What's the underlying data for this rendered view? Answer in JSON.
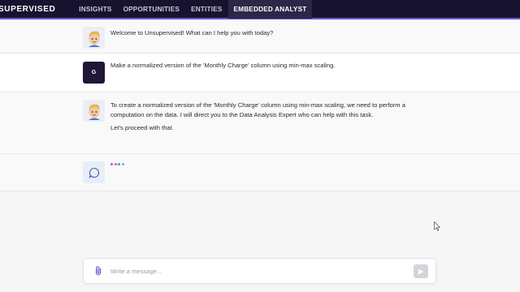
{
  "brand": "SUPERVISED",
  "nav": {
    "items": [
      {
        "label": "INSIGHTS"
      },
      {
        "label": "OPPORTUNITIES"
      },
      {
        "label": "ENTITIES"
      },
      {
        "label": "EMBEDDED ANALYST"
      }
    ],
    "active_index": 3
  },
  "conversation": {
    "messages": [
      {
        "role": "assistant",
        "avatar": "memoji-avatar",
        "paragraphs": [
          "Welcome to Unsupervised! What can I help you with today?"
        ]
      },
      {
        "role": "user",
        "avatar_initial": "G",
        "paragraphs": [
          "Make a normalized version of the 'Monthly Charge' column using min-max scaling."
        ]
      },
      {
        "role": "assistant",
        "avatar": "memoji-avatar",
        "paragraphs": [
          "To create a normalized version of the 'Monthly Charge' column using min-max scaling, we need to perform a computation on the data. I will direct you to the Data Analysis Expert who can help with this task.",
          "Let's proceed with that."
        ]
      },
      {
        "role": "assistant-typing",
        "avatar": "chat-bubble-icon"
      }
    ],
    "typing_dot_colors": [
      "#7b6cf0",
      "#e0628f",
      "#4c8ee8",
      "#55c2c9"
    ]
  },
  "composer": {
    "placeholder": "Write a message...",
    "value": ""
  },
  "colors": {
    "topbar": "#17132f",
    "accent": "#6b5bd6",
    "user_avatar": "#1f1638"
  }
}
